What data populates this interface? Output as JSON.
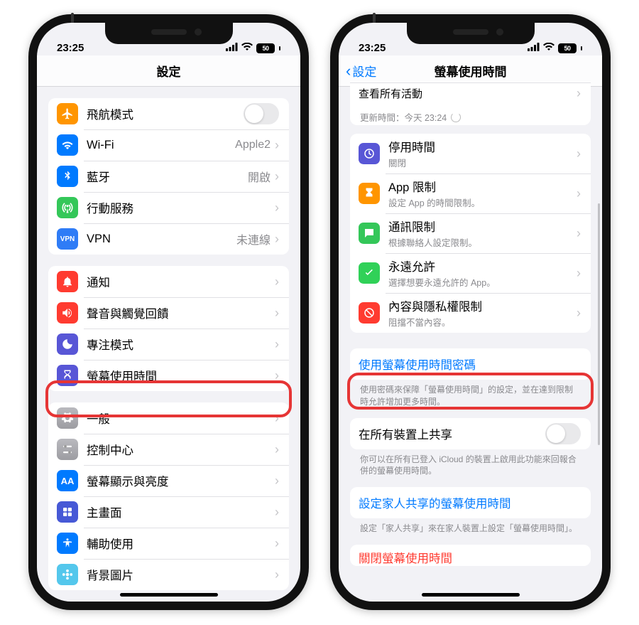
{
  "status": {
    "time": "23:25",
    "battery": "50"
  },
  "left": {
    "title": "設定",
    "rows": {
      "airplane": "飛航模式",
      "wifi": {
        "label": "Wi-Fi",
        "value": "Apple2"
      },
      "bluetooth": {
        "label": "藍牙",
        "value": "開啟"
      },
      "cellular": "行動服務",
      "vpn": {
        "label": "VPN",
        "value": "未連線"
      },
      "notifications": "通知",
      "sounds": "聲音與觸覺回饋",
      "focus": "專注模式",
      "screentime": "螢幕使用時間",
      "general": "一般",
      "control": "控制中心",
      "display": "螢幕顯示與亮度",
      "home": "主畫面",
      "accessibility": "輔助使用",
      "wallpaper": "背景圖片"
    }
  },
  "right": {
    "back": "設定",
    "title": "螢幕使用時間",
    "seeall": "查看所有活動",
    "update": "更新時間：今天 23:24",
    "items": {
      "downtime": {
        "label": "停用時間",
        "sub": "關閉"
      },
      "applimits": {
        "label": "App 限制",
        "sub": "設定 App 的時間限制。"
      },
      "comm": {
        "label": "通訊限制",
        "sub": "根據聯絡人設定限制。"
      },
      "always": {
        "label": "永遠允許",
        "sub": "選擇想要永遠允許的 App。"
      },
      "content": {
        "label": "內容與隱私權限制",
        "sub": "阻擋不當內容。"
      }
    },
    "passcode": "使用螢幕使用時間密碼",
    "passcode_foot": "使用密碼來保障「螢幕使用時間」的設定，並在達到限制時允許增加更多時間。",
    "sharedevices": "在所有裝置上共享",
    "sharedevices_foot": "你可以在所有已登入 iCloud 的裝置上啟用此功能來回報合併的螢幕使用時間。",
    "family": "設定家人共享的螢幕使用時間",
    "family_foot": "設定「家人共享」來在家人裝置上設定「螢幕使用時間」。",
    "turnoff": "關閉螢幕使用時間"
  }
}
